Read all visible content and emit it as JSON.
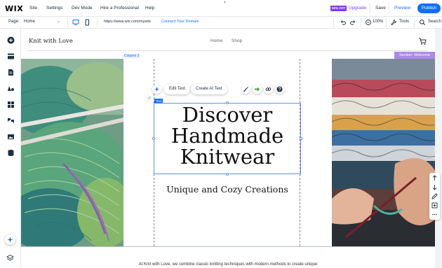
{
  "topbar": {
    "logo": "WIX",
    "menu": [
      "Site",
      "Settings",
      "Dev Mode",
      "Hire a Professional",
      "Help"
    ],
    "discount_badge": "50% OFF",
    "upgrade": "Upgrade",
    "save": "Save",
    "preview": "Preview",
    "publish": "Publish"
  },
  "secondbar": {
    "page_label": "Page:",
    "page_value": "Home",
    "url": "https://www.wix.com/mysite",
    "connect_domain": "Connect Your Domain",
    "zoom": "100%",
    "tools": "Tools",
    "search": "Search"
  },
  "site": {
    "brand": "Knit with Love",
    "nav": [
      "Home",
      "Shop"
    ],
    "heading_lines": [
      "Discover",
      "Handmade",
      "Knitwear"
    ],
    "subheading": "Unique and Cozy Creations",
    "bottom_text": "At Knit with Love, we combine classic knitting techniques with modern methods to create unique"
  },
  "editor": {
    "column_label": "Column 2",
    "section_label": "Section: Welcome",
    "text_tag": "Text",
    "edit_text": "Edit Text",
    "create_ai_text": "Create AI Text"
  },
  "colors": {
    "accent": "#116dff",
    "upgrade_purple": "#7a3ff2",
    "section_label": "#a98ae8"
  }
}
